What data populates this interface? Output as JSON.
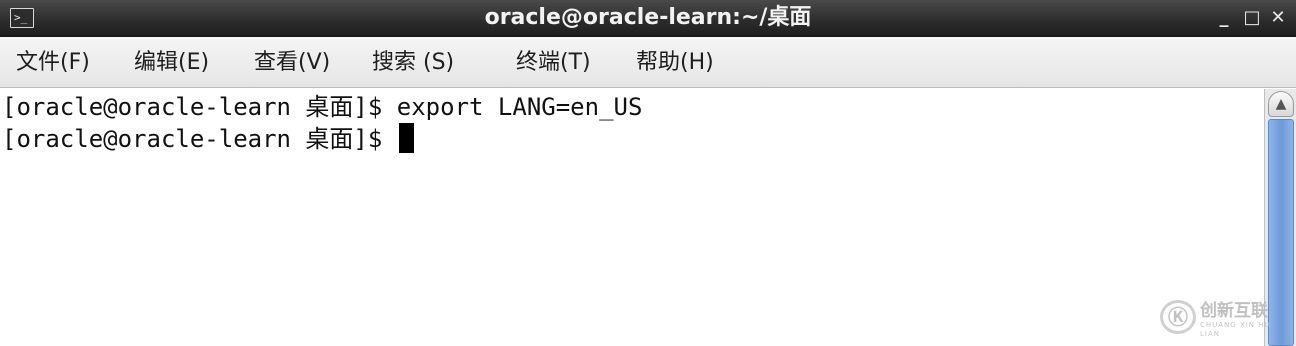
{
  "window": {
    "title": "oracle@oracle-learn:~/桌面",
    "app_icon": "terminal-icon",
    "controls": {
      "minimize": "_",
      "maximize": "□",
      "close": "✕"
    }
  },
  "menu": {
    "items": [
      {
        "label": "文件(F)"
      },
      {
        "label": "编辑(E)"
      },
      {
        "label": "查看(V)"
      },
      {
        "label": "搜索 (S)"
      },
      {
        "label": "终端(T)"
      },
      {
        "label": "帮助(H)"
      }
    ]
  },
  "terminal": {
    "lines": [
      {
        "prompt": "[oracle@oracle-learn 桌面]$ ",
        "command": "export LANG=en_US"
      },
      {
        "prompt": "[oracle@oracle-learn 桌面]$ ",
        "command": ""
      }
    ]
  },
  "scrollbar": {
    "up_arrow": "▲"
  },
  "watermark": {
    "logo": "Ⓚ",
    "text": "创新互联",
    "subtext": "CHUANG XIN HU LIAN"
  },
  "colors": {
    "titlebar": "#2b2b2b",
    "scroll_thumb": "#6d9ad8",
    "cursor": "#000000"
  }
}
